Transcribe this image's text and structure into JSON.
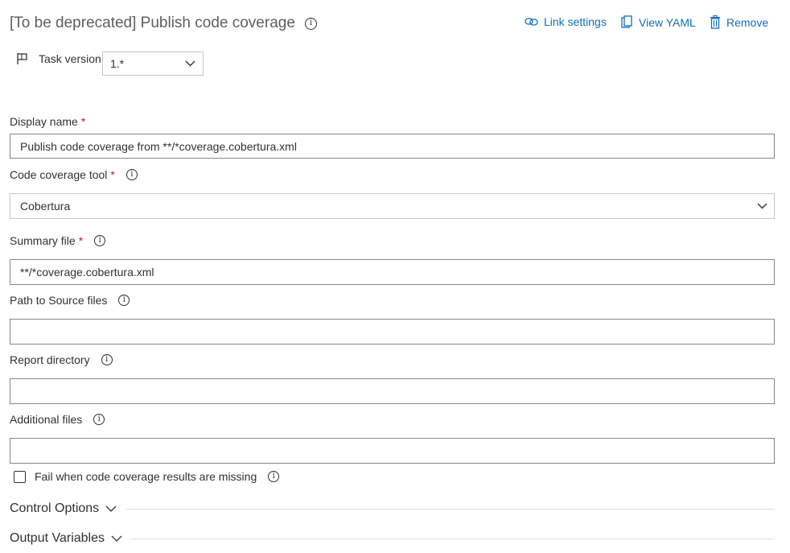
{
  "header": {
    "title": "[To be deprecated] Publish code coverage",
    "actions": [
      {
        "label": "Link settings",
        "icon": "link-icon"
      },
      {
        "label": "View YAML",
        "icon": "clipboard-icon"
      },
      {
        "label": "Remove",
        "icon": "trash-icon"
      }
    ]
  },
  "task_version": {
    "label": "Task version",
    "value": "1.*",
    "icon": "flag-icon"
  },
  "fields": {
    "display_name": {
      "label": "Display name",
      "required": "*",
      "value": "Publish code coverage from **/*coverage.cobertura.xml"
    },
    "coverage_tool": {
      "label": "Code coverage tool",
      "required": "*",
      "value": "Cobertura"
    },
    "summary_file": {
      "label": "Summary file",
      "required": "*",
      "value": "**/*coverage.cobertura.xml"
    },
    "source_path": {
      "label": "Path to Source files",
      "value": ""
    },
    "report_dir": {
      "label": "Report directory",
      "value": ""
    },
    "additional_files": {
      "label": "Additional files",
      "value": ""
    }
  },
  "checkbox": {
    "label": "Fail when code coverage results are missing",
    "checked": false
  },
  "sections": [
    {
      "label": "Control Options"
    },
    {
      "label": "Output Variables"
    }
  ],
  "colors": {
    "accent": "#106ebe",
    "required": "#a4262c",
    "border": "#8a8886"
  }
}
